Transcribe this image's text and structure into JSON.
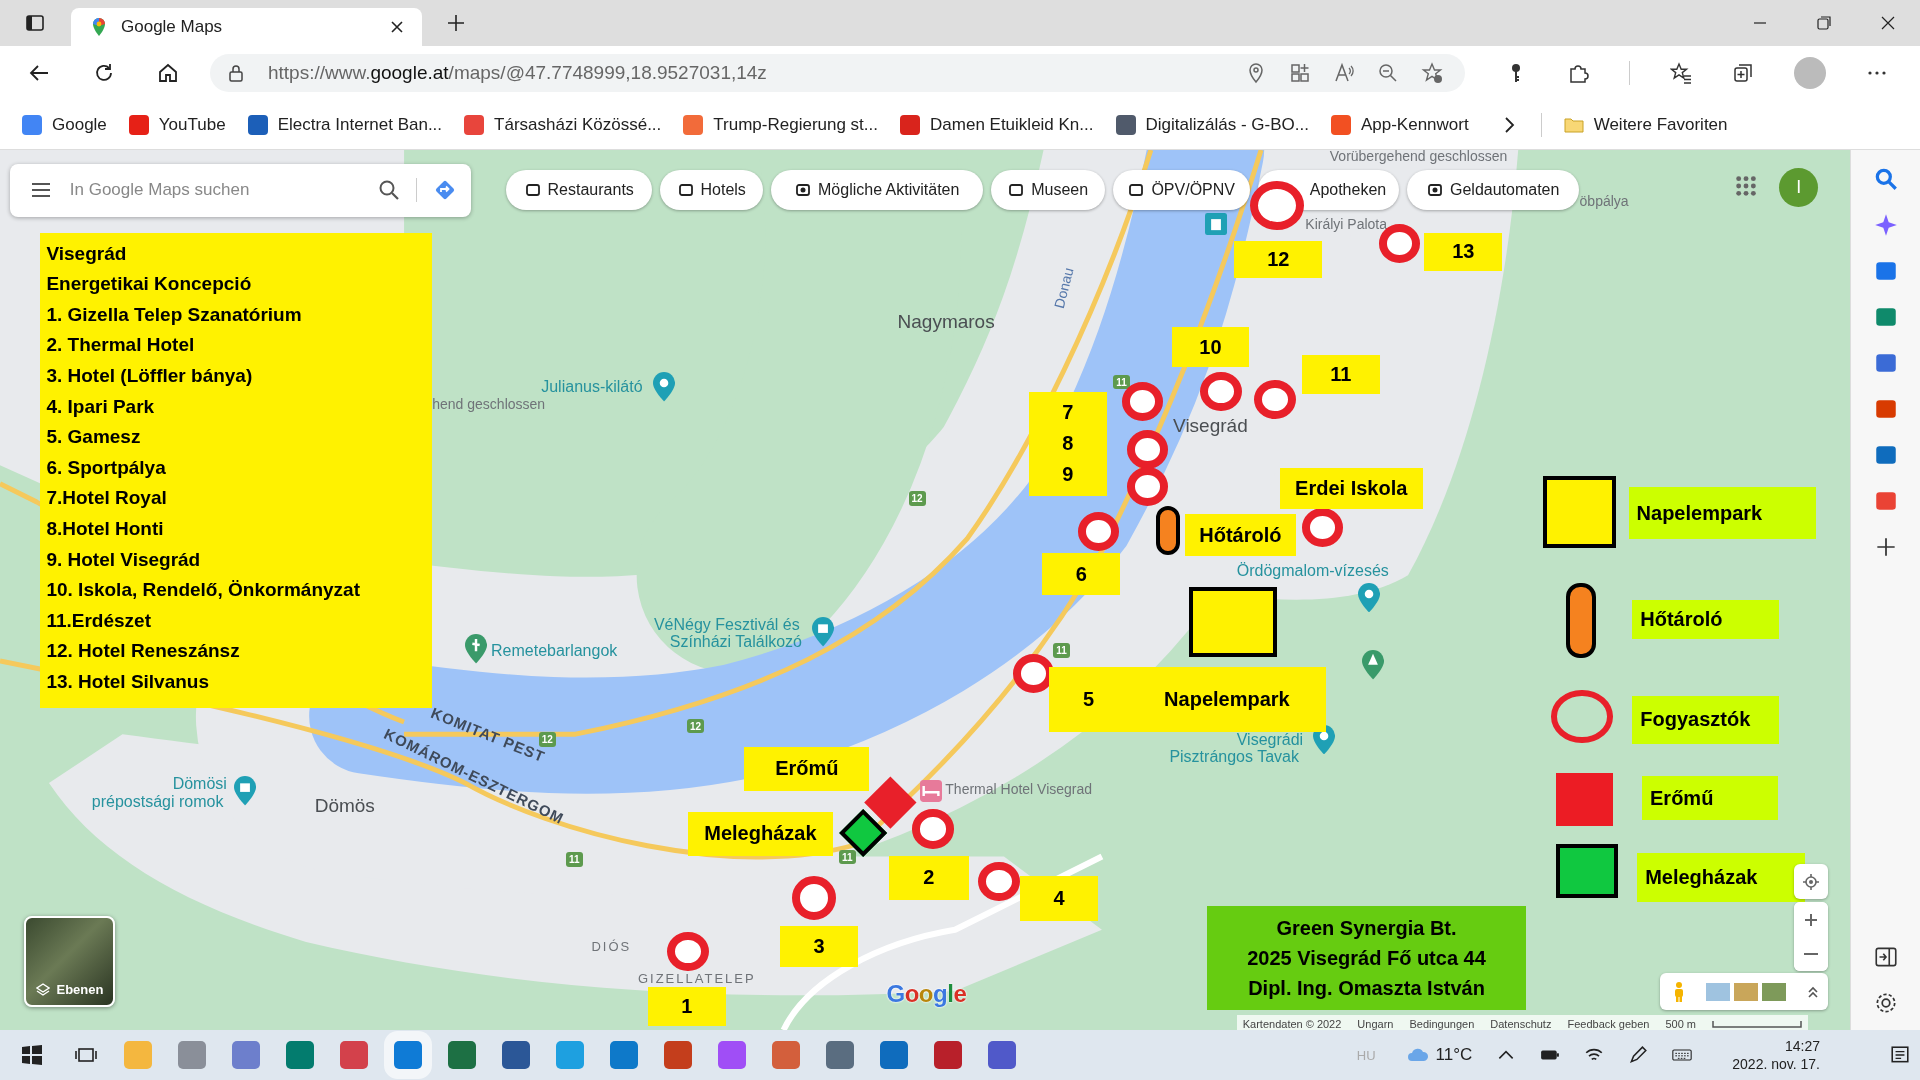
{
  "browser": {
    "tab_title": "Google Maps",
    "url_scheme": "https://www.",
    "url_domain": "google.at",
    "url_path": "/maps/@47.7748999,18.9527031,14z"
  },
  "bookmarks": [
    {
      "label": "Google"
    },
    {
      "label": "YouTube"
    },
    {
      "label": "Electra Internet Ban..."
    },
    {
      "label": "Társasházi Közössé..."
    },
    {
      "label": "Trump-Regierung st..."
    },
    {
      "label": "Damen Etuikleid Kn..."
    },
    {
      "label": "Digitalizálás - G-BO..."
    },
    {
      "label": "App-Kennwort"
    }
  ],
  "other_favorites": "Weitere Favoriten",
  "maps": {
    "search_placeholder": "In Google Maps suchen",
    "chips": [
      "Restaurants",
      "Hotels",
      "Mögliche Aktivitäten",
      "Museen",
      "ÖPV/ÖPNV",
      "Apotheken",
      "Geldautomaten"
    ],
    "account_initial": "I",
    "layers_label": "Ebenen",
    "logo": "Google",
    "attribution": [
      "Kartendaten © 2022",
      "Ungarn",
      "Bedingungen",
      "Datenschutz",
      "Feedback geben"
    ],
    "scale": "500 m"
  },
  "place_names": [
    {
      "kind": "town",
      "text": "Nagymaros"
    },
    {
      "kind": "town",
      "text": "Visegrád"
    },
    {
      "kind": "town",
      "text": "Dömös"
    },
    {
      "kind": "poi",
      "text": "Julianus-kilátó"
    },
    {
      "kind": "poi",
      "text": "Remetebarlangok"
    },
    {
      "kind": "poi",
      "text": "VéNégy Fesztivál és"
    },
    {
      "kind": "poi",
      "text": "Színházi Találkozó"
    },
    {
      "kind": "poi",
      "text": "Dömösi"
    },
    {
      "kind": "poi",
      "text": "prépostsági romok"
    },
    {
      "kind": "poi",
      "text": "Ördögmalom-vízesés"
    },
    {
      "kind": "poi",
      "text": "Visegrádi"
    },
    {
      "kind": "poi",
      "text": "Pisztrángos Tavak"
    },
    {
      "kind": "label",
      "text": "Thermal Hotel Visegrad"
    },
    {
      "kind": "label",
      "text": "Királyi Palota"
    },
    {
      "kind": "district",
      "text": "DIÓS"
    },
    {
      "kind": "district",
      "text": "GIZELLATELEP"
    },
    {
      "kind": "label",
      "text": "Vorübergehend geschlossen"
    },
    {
      "kind": "label",
      "text": "hend geschlossen"
    },
    {
      "kind": "label",
      "text": "öbpálya"
    },
    {
      "kind": "region",
      "text": "KOMITAT PEST"
    },
    {
      "kind": "region",
      "text": "KOMÁROM-ESZTERGOM"
    },
    {
      "kind": "river",
      "text": "Donau"
    }
  ],
  "road_shields": [
    "12",
    "11",
    "11",
    "12",
    "12",
    "11",
    "11"
  ],
  "legend": {
    "title": [
      "Visegrád",
      "Energetikai Koncepció"
    ],
    "items": [
      "1. Gizella Telep Szanatórium",
      "2. Thermal Hotel",
      "3. Hotel (Löffler bánya)",
      "4. Ipari Park",
      "5. Gamesz",
      "6. Sportpálya",
      "7.Hotel Royal",
      "8.Hotel Honti",
      "9. Hotel Visegrád",
      "10. Iskola, Rendelő, Önkormányzat",
      "11.Erdészet",
      "12. Hotel Reneszánsz",
      "13. Hotel Silvanus"
    ]
  },
  "markers": [
    {
      "kind": "consumer"
    },
    {
      "kind": "consumer"
    },
    {
      "kind": "consumer"
    },
    {
      "kind": "consumer"
    },
    {
      "kind": "consumer"
    },
    {
      "kind": "consumer"
    },
    {
      "kind": "consumer"
    },
    {
      "kind": "consumer"
    },
    {
      "kind": "consumer"
    },
    {
      "kind": "consumer"
    },
    {
      "kind": "consumer"
    },
    {
      "kind": "consumer"
    },
    {
      "kind": "consumer"
    },
    {
      "kind": "consumer"
    },
    {
      "kind": "storage"
    },
    {
      "kind": "solar"
    },
    {
      "kind": "plant"
    },
    {
      "kind": "greenhouse"
    }
  ],
  "marker_labels": [
    "12",
    "13",
    "10",
    "11",
    "7\n8\n9",
    "Erdei Iskola",
    "Hőtároló",
    "6",
    "5",
    "Napelempark",
    "Erőmű",
    "Melegházak",
    "2",
    "4",
    "3",
    "1"
  ],
  "key": [
    {
      "kind": "solar",
      "label": "Napelempark"
    },
    {
      "kind": "storage",
      "label": "Hőtároló"
    },
    {
      "kind": "consumer",
      "label": "Fogyasztók"
    },
    {
      "kind": "plant",
      "label": "Erőmű"
    },
    {
      "kind": "greenhouse",
      "label": "Melegházak"
    }
  ],
  "company": [
    "Green Synergia Bt.",
    "2025 Visegrád Fő utca 44",
    "Dipl. Ing. Omaszta István"
  ],
  "taskbar": {
    "input_language": "HU",
    "temperature": "11°C",
    "time": "14:27",
    "date": "2022. nov. 17."
  }
}
